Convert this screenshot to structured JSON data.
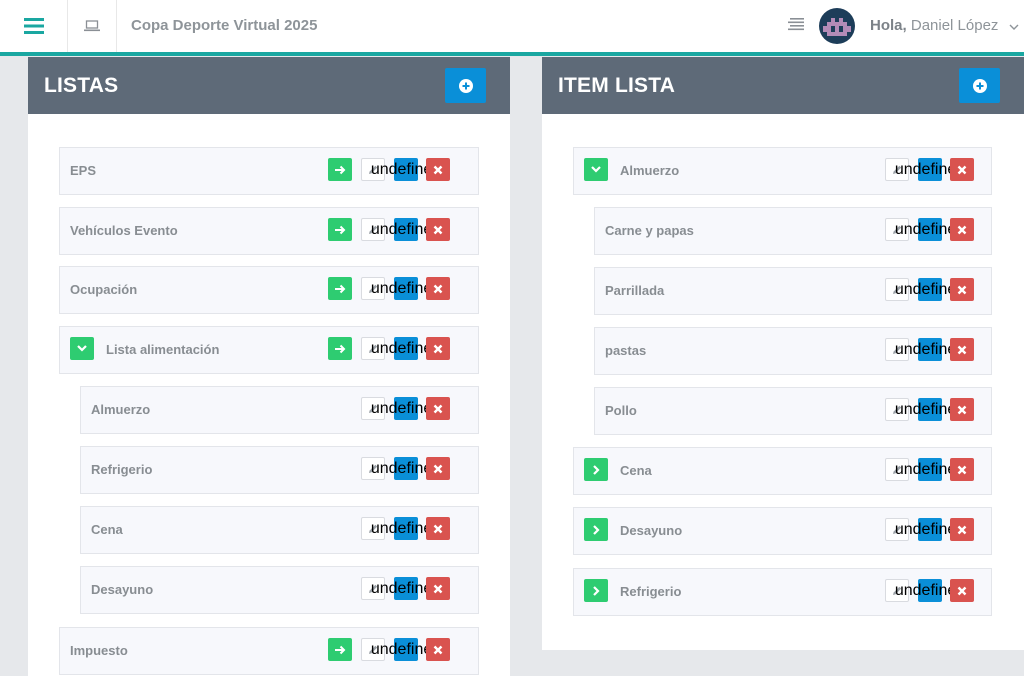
{
  "app": {
    "title": "Copa Deporte Virtual 2025",
    "greeting": "Hola,",
    "user_name": "Daniel López"
  },
  "colors": {
    "accent_teal": "#1aa7a1",
    "header_slate": "#5e6a78",
    "primary_blue": "#0a8fd8",
    "success_green": "#2ecc71",
    "danger_red": "#d9534f"
  },
  "icons": {
    "menu": "hamburger-icon",
    "laptop": "laptop-icon",
    "list": "list-icon",
    "avatar": "pixel-avatar",
    "add": "plus-circle-icon",
    "go": "arrow-right-icon",
    "edit": "pencil-icon",
    "plus": "plus-icon",
    "delete": "times-icon",
    "expanded": "chevron-down-icon",
    "collapsed": "chevron-right-icon"
  },
  "left_panel": {
    "title": "LISTAS",
    "rows": [
      {
        "label": "EPS",
        "toggle": null,
        "go": true
      },
      {
        "label": "Vehículos Evento",
        "toggle": null,
        "go": true
      },
      {
        "label": "Ocupación",
        "toggle": null,
        "go": true
      },
      {
        "label": "Lista alimentación",
        "toggle": "expanded",
        "go": true
      },
      {
        "label": "Almuerzo",
        "toggle": null,
        "go": false
      },
      {
        "label": "Refrigerio",
        "toggle": null,
        "go": false
      },
      {
        "label": "Cena",
        "toggle": null,
        "go": false
      },
      {
        "label": "Desayuno",
        "toggle": null,
        "go": false
      },
      {
        "label": "Impuesto",
        "toggle": null,
        "go": true
      }
    ]
  },
  "right_panel": {
    "title": "ITEM LISTA",
    "rows": [
      {
        "label": "Almuerzo",
        "toggle": "expanded"
      },
      {
        "label": "Carne y papas",
        "toggle": null
      },
      {
        "label": "Parrillada",
        "toggle": null
      },
      {
        "label": "pastas",
        "toggle": null
      },
      {
        "label": "Pollo",
        "toggle": null
      },
      {
        "label": "Cena",
        "toggle": "collapsed"
      },
      {
        "label": "Desayuno",
        "toggle": "collapsed"
      },
      {
        "label": "Refrigerio",
        "toggle": "collapsed"
      }
    ]
  }
}
